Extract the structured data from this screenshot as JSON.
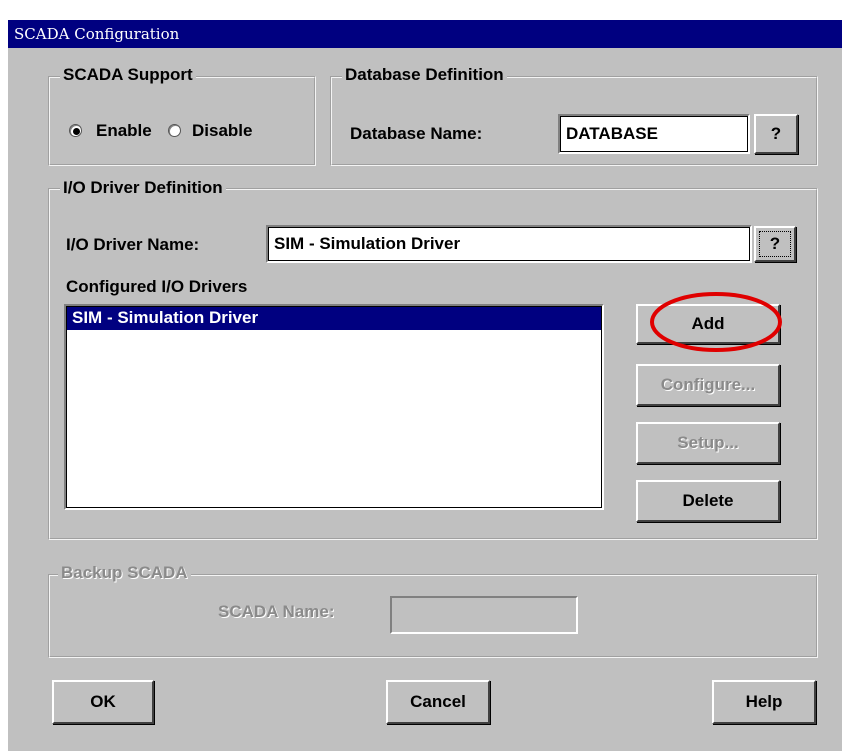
{
  "window": {
    "title": "SCADA Configuration"
  },
  "scada_support": {
    "legend": "SCADA Support",
    "options": [
      {
        "label": "Enable",
        "selected": true
      },
      {
        "label": "Disable",
        "selected": false
      }
    ]
  },
  "database": {
    "legend": "Database Definition",
    "name_label": "Database Name:",
    "name_value": "DATABASE",
    "help_label": "?"
  },
  "io_driver": {
    "legend": "I/O Driver Definition",
    "name_label": "I/O Driver Name:",
    "name_value": "SIM - Simulation Driver",
    "help_label": "?",
    "list_label": "Configured I/O Drivers",
    "list_items": [
      "SIM - Simulation Driver"
    ],
    "buttons": {
      "add": "Add",
      "configure": "Configure...",
      "setup": "Setup...",
      "delete": "Delete"
    }
  },
  "backup": {
    "legend": "Backup SCADA",
    "name_label": "SCADA Name:",
    "name_value": ""
  },
  "footer": {
    "ok": "OK",
    "cancel": "Cancel",
    "help": "Help"
  },
  "colors": {
    "title_bar": "#000080",
    "face": "#c0c0c0",
    "highlight_circle": "#e00000",
    "selection": "#000080"
  }
}
